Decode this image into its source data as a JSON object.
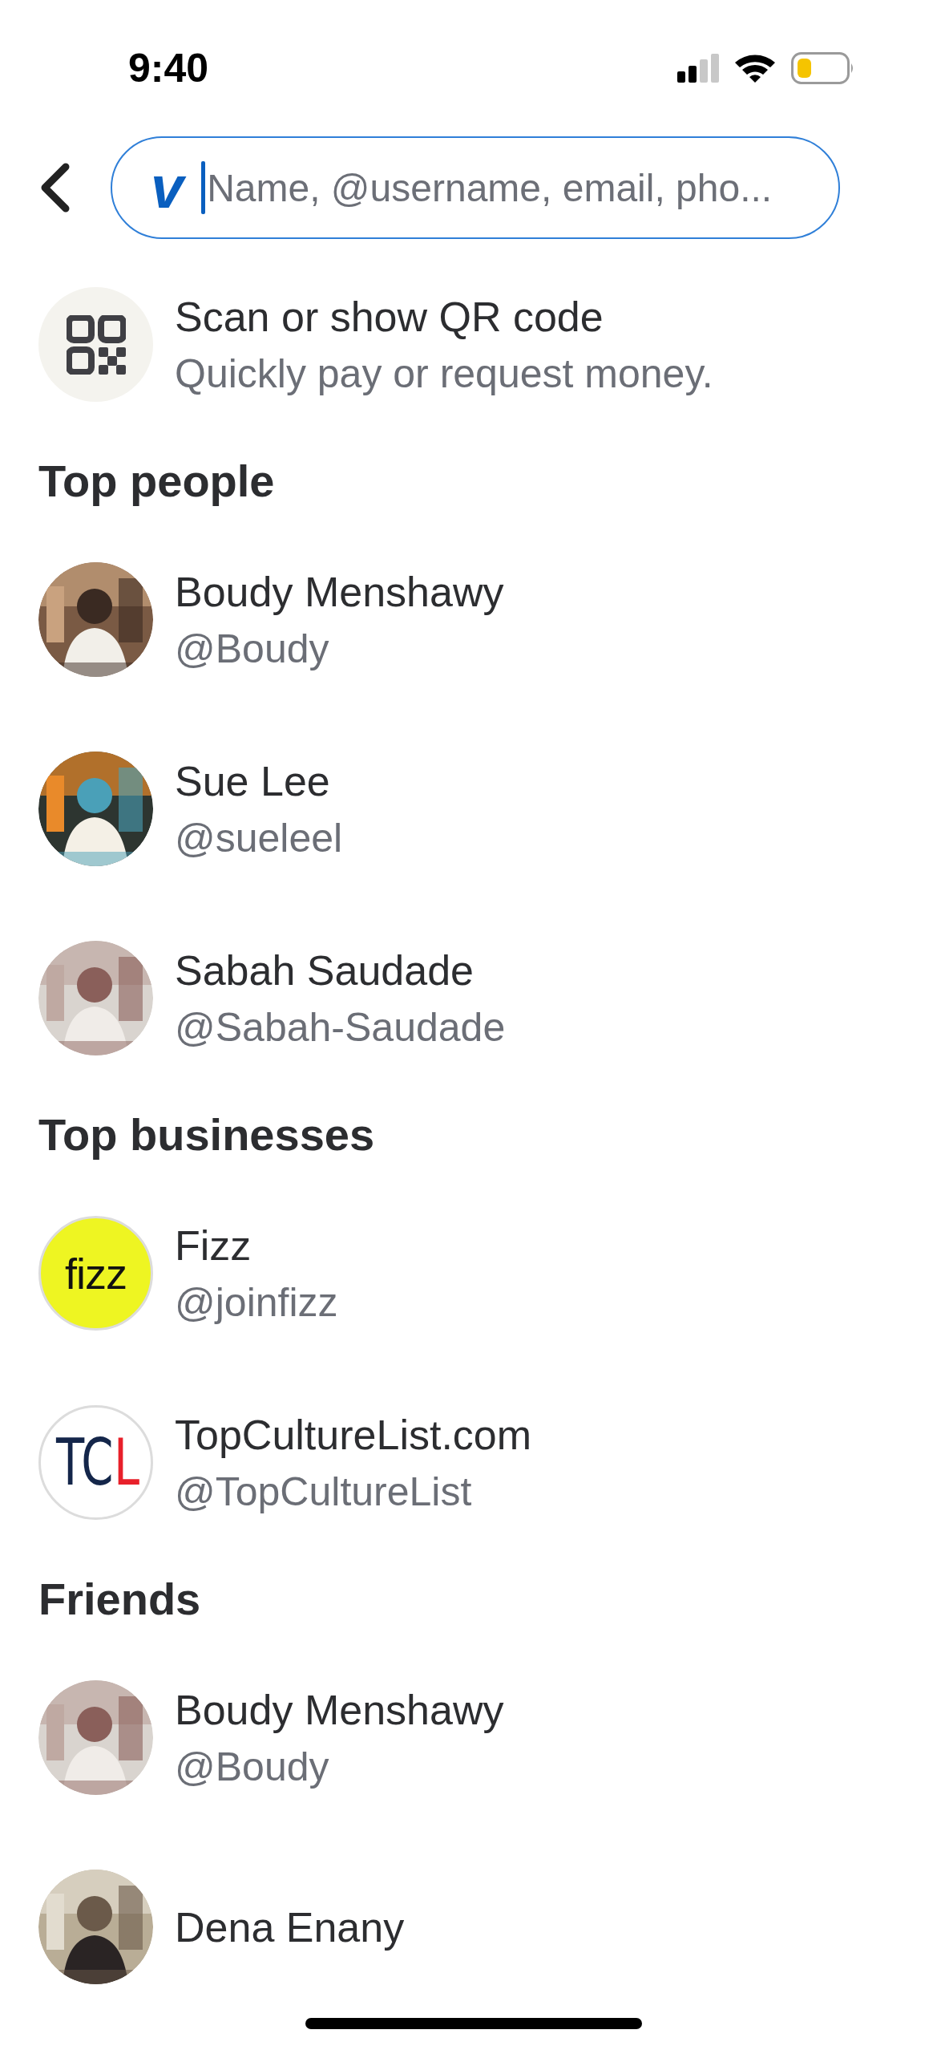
{
  "status_bar": {
    "time": "9:40"
  },
  "search": {
    "logo": "v",
    "placeholder": "Name, @username, email, pho..."
  },
  "qr": {
    "title": "Scan or show QR code",
    "subtitle": "Quickly pay or request money."
  },
  "sections": [
    {
      "title": "Top people",
      "items": [
        {
          "name": "Boudy Menshawy",
          "handle": "@Boudy"
        },
        {
          "name": "Sue Lee",
          "handle": "@sueleel"
        },
        {
          "name": "Sabah Saudade",
          "handle": "@Sabah-Saudade"
        }
      ]
    },
    {
      "title": "Top businesses",
      "items": [
        {
          "name": "Fizz",
          "handle": "@joinfizz",
          "avatar": {
            "kind": "logo",
            "color": "#eef522",
            "parts": [
              {
                "text": "fizz",
                "color": "#111111"
              }
            ]
          }
        },
        {
          "name": "TopCultureList.com",
          "handle": "@TopCultureList",
          "avatar": {
            "kind": "logo",
            "color": "#ffffff",
            "parts": [
              {
                "text": "TC",
                "color": "#14264a"
              },
              {
                "text": "L",
                "color": "#e8202a"
              }
            ]
          }
        }
      ]
    },
    {
      "title": "Friends",
      "items": [
        {
          "name": "Boudy Menshawy",
          "handle": "@Boudy"
        },
        {
          "name": "Dena Enany"
        }
      ]
    }
  ]
}
